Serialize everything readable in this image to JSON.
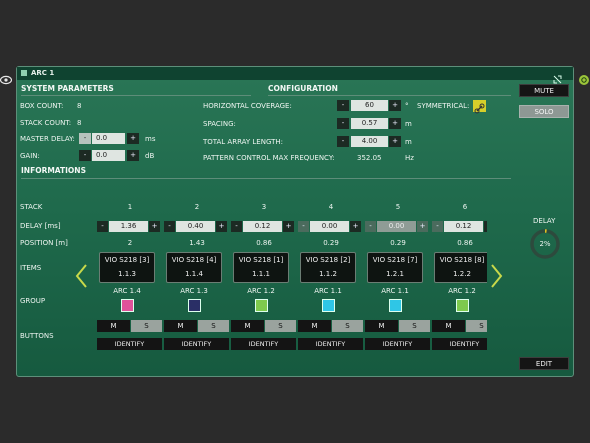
{
  "window": {
    "title": "ARC 1"
  },
  "sections": {
    "system": "SYSTEM PARAMETERS",
    "configuration": "CONFIGURATION",
    "informations": "INFORMATIONS"
  },
  "system": {
    "box_count_label": "BOX COUNT:",
    "box_count": "8",
    "stack_count_label": "STACK COUNT:",
    "stack_count": "8",
    "master_delay_label": "MASTER DELAY:",
    "master_delay": "0.0",
    "master_delay_unit": "ms",
    "gain_label": "GAIN:",
    "gain": "0.0",
    "gain_unit": "dB"
  },
  "config": {
    "hcov_label": "HORIZONTAL COVERAGE:",
    "hcov": "60",
    "hcov_unit": "°",
    "symmetrical_label": "SYMMETRICAL:",
    "spacing_label": "SPACING:",
    "spacing": "0.57",
    "spacing_unit": "m",
    "tal_label": "TOTAL ARRAY LENGTH:",
    "tal": "4.00",
    "tal_unit": "m",
    "pcmf_label": "PATTERN CONTROL MAX FREQUENCY:",
    "pcmf": "352.05",
    "pcmf_unit": "Hz"
  },
  "controls": {
    "minus": "-",
    "plus": "+"
  },
  "row_labels": {
    "stack": "STACK",
    "delay": "DELAY [ms]",
    "position": "POSITION [m]",
    "items": "ITEMS",
    "group": "GROUP",
    "buttons": "BUTTONS"
  },
  "columns": [
    {
      "stack": "1",
      "delay": "1.36",
      "position": "2",
      "item_name": "VIO S218 [3]",
      "item_id": "1.1.3",
      "group": "ARC 1.4",
      "color": "#e0529a",
      "mute": "M",
      "solo": "S",
      "identify": "IDENTIFY"
    },
    {
      "stack": "2",
      "delay": "0.40",
      "position": "1.43",
      "item_name": "VIO S218 [4]",
      "item_id": "1.1.4",
      "group": "ARC 1.3",
      "color": "#2a2f66",
      "mute": "M",
      "solo": "S",
      "identify": "IDENTIFY"
    },
    {
      "stack": "3",
      "delay": "0.12",
      "position": "0.86",
      "item_name": "VIO S218 [1]",
      "item_id": "1.1.1",
      "group": "ARC 1.2",
      "color": "#7ec94d",
      "mute": "M",
      "solo": "S",
      "identify": "IDENTIFY"
    },
    {
      "stack": "4",
      "delay": "0.00",
      "position": "0.29",
      "item_name": "VIO S218 [2]",
      "item_id": "1.1.2",
      "group": "ARC 1.1",
      "color": "#2fc6e6",
      "mute": "M",
      "solo": "S",
      "identify": "IDENTIFY"
    },
    {
      "stack": "5",
      "delay": "0.00",
      "position": "0.29",
      "item_name": "VIO S218 [7]",
      "item_id": "1.2.1",
      "group": "ARC 1.1",
      "color": "#2fc6e6",
      "mute": "M",
      "solo": "S",
      "identify": "IDENTIFY"
    },
    {
      "stack": "6",
      "delay": "0.12",
      "position": "0.86",
      "item_name": "VIO S218 [8]",
      "item_id": "1.2.2",
      "group": "ARC 1.2",
      "color": "#7ec94d",
      "mute": "M",
      "solo": "S",
      "identify": "IDENTIFY"
    }
  ],
  "side": {
    "mute": "MUTE",
    "solo": "SOLO",
    "delay_label": "DELAY",
    "delay_value": "2%",
    "delay_fraction": 0.02,
    "edit": "EDIT"
  },
  "icons": {
    "eye": "eye-icon",
    "expand": "expand-icon",
    "symmetrical_link": "link-icon",
    "prev": "chevron-left-icon",
    "next": "chevron-right-icon",
    "settings": "gear-icon"
  }
}
